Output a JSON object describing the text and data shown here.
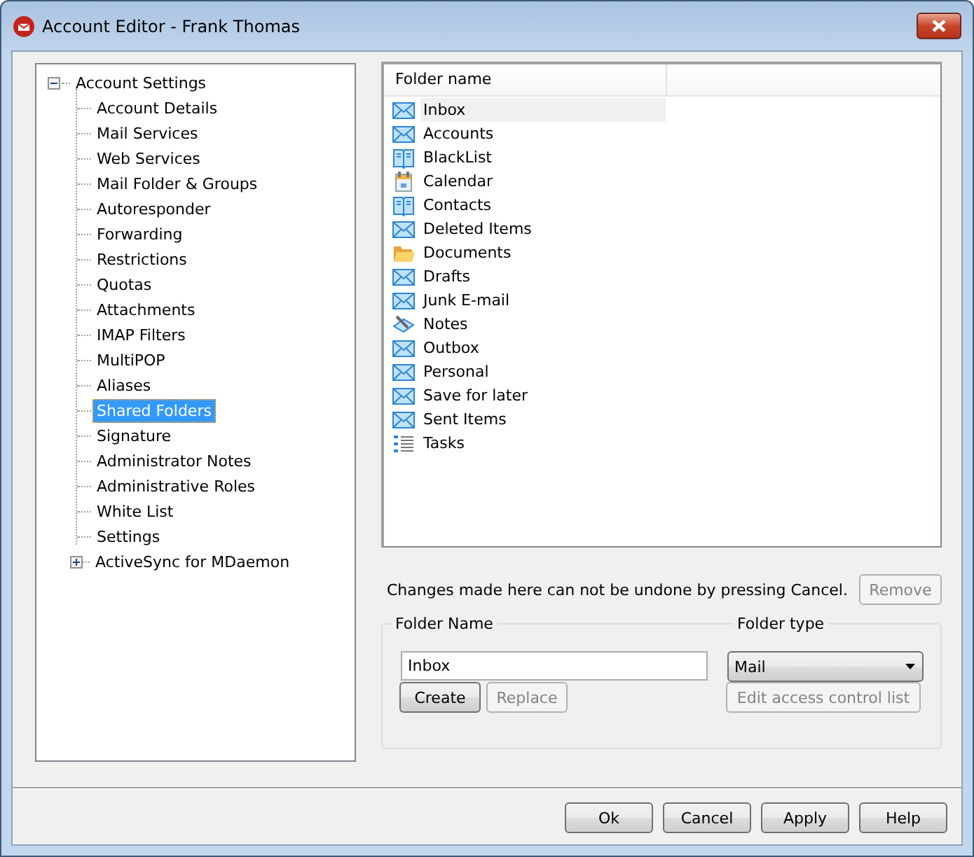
{
  "window": {
    "title": "Account Editor - Frank Thomas"
  },
  "tree": {
    "label": "Account Settings",
    "expanded": true,
    "children": [
      {
        "label": "Account Details",
        "selected": false
      },
      {
        "label": "Mail Services",
        "selected": false
      },
      {
        "label": "Web Services",
        "selected": false
      },
      {
        "label": "Mail Folder & Groups",
        "selected": false
      },
      {
        "label": "Autoresponder",
        "selected": false
      },
      {
        "label": "Forwarding",
        "selected": false
      },
      {
        "label": "Restrictions",
        "selected": false
      },
      {
        "label": "Quotas",
        "selected": false
      },
      {
        "label": "Attachments",
        "selected": false
      },
      {
        "label": "IMAP Filters",
        "selected": false
      },
      {
        "label": "MultiPOP",
        "selected": false
      },
      {
        "label": "Aliases",
        "selected": false
      },
      {
        "label": "Shared Folders",
        "selected": true
      },
      {
        "label": "Signature",
        "selected": false
      },
      {
        "label": "Administrator Notes",
        "selected": false
      },
      {
        "label": "Administrative Roles",
        "selected": false
      },
      {
        "label": "White List",
        "selected": false
      },
      {
        "label": "Settings",
        "selected": false
      },
      {
        "label": "ActiveSync for MDaemon",
        "selected": false,
        "expanded": false
      }
    ]
  },
  "folder_table": {
    "columns": [
      "Folder name"
    ],
    "rows": [
      {
        "name": "Inbox",
        "kind": "mail",
        "selected": true
      },
      {
        "name": "Accounts",
        "kind": "mail",
        "selected": false
      },
      {
        "name": "BlackList",
        "kind": "book",
        "selected": false
      },
      {
        "name": "Calendar",
        "kind": "calendar",
        "selected": false
      },
      {
        "name": "Contacts",
        "kind": "book",
        "selected": false
      },
      {
        "name": "Deleted Items",
        "kind": "mail",
        "selected": false
      },
      {
        "name": "Documents",
        "kind": "folder",
        "selected": false
      },
      {
        "name": "Drafts",
        "kind": "mail",
        "selected": false
      },
      {
        "name": "Junk E-mail",
        "kind": "mail",
        "selected": false
      },
      {
        "name": "Notes",
        "kind": "notes",
        "selected": false
      },
      {
        "name": "Outbox",
        "kind": "mail",
        "selected": false
      },
      {
        "name": "Personal",
        "kind": "mail",
        "selected": false
      },
      {
        "name": "Save for later",
        "kind": "mail",
        "selected": false
      },
      {
        "name": "Sent Items",
        "kind": "mail",
        "selected": false
      },
      {
        "name": "Tasks",
        "kind": "tasks",
        "selected": false
      }
    ]
  },
  "notice": "Changes made here can not be undone by pressing Cancel.",
  "remove_button": {
    "label": "Remove",
    "disabled": true
  },
  "folder_form": {
    "name_label": "Folder Name",
    "name_value": "Inbox",
    "type_label": "Folder type",
    "type_value": "Mail",
    "buttons": [
      {
        "label": "Create",
        "disabled": false
      },
      {
        "label": "Replace",
        "disabled": true
      }
    ],
    "acl_button": {
      "label": "Edit access control list",
      "disabled": true
    }
  },
  "dialog_buttons": [
    {
      "label": "Ok"
    },
    {
      "label": "Cancel"
    },
    {
      "label": "Apply"
    },
    {
      "label": "Help"
    }
  ]
}
